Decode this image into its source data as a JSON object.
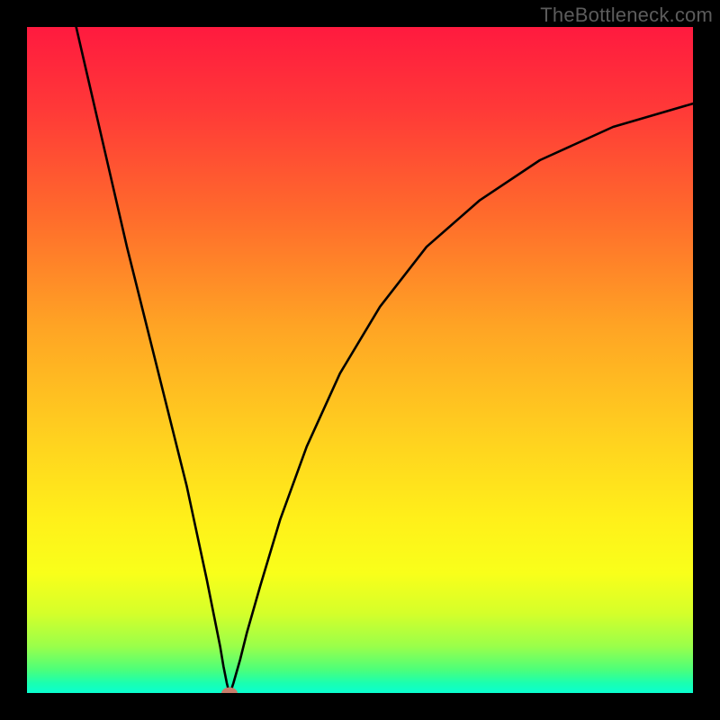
{
  "watermark": "TheBottleneck.com",
  "chart_data": {
    "type": "line",
    "title": "",
    "xlabel": "",
    "ylabel": "",
    "xlim": [
      0,
      100
    ],
    "ylim": [
      0,
      100
    ],
    "grid": false,
    "background": "vertical-gradient red→orange→yellow→green",
    "series": [
      {
        "name": "bottleneck-curve",
        "x": [
          0,
          3,
          6,
          9,
          12,
          15,
          18,
          21,
          24,
          27,
          28,
          29,
          29.5,
          30,
          30.3,
          30.6,
          31,
          32,
          33,
          35,
          38,
          42,
          47,
          53,
          60,
          68,
          77,
          88,
          100
        ],
        "y": [
          134,
          120,
          106,
          93,
          80,
          67,
          55,
          43,
          31,
          17,
          12,
          7,
          4,
          1.5,
          0.3,
          0.3,
          1.5,
          5,
          9,
          16,
          26,
          37,
          48,
          58,
          67,
          74,
          80,
          85,
          88.5
        ]
      }
    ],
    "marker": {
      "x": 30.4,
      "y": 0.0,
      "color": "#c97d6c",
      "radius": 1.2
    },
    "gradient_stops": [
      {
        "offset": 0.0,
        "color": "#ff1a3f"
      },
      {
        "offset": 0.12,
        "color": "#ff3838"
      },
      {
        "offset": 0.28,
        "color": "#ff6a2c"
      },
      {
        "offset": 0.45,
        "color": "#ffa424"
      },
      {
        "offset": 0.62,
        "color": "#ffd21f"
      },
      {
        "offset": 0.74,
        "color": "#fff01a"
      },
      {
        "offset": 0.82,
        "color": "#f9ff1a"
      },
      {
        "offset": 0.88,
        "color": "#d5ff2a"
      },
      {
        "offset": 0.93,
        "color": "#9aff4a"
      },
      {
        "offset": 0.965,
        "color": "#4cff7a"
      },
      {
        "offset": 0.985,
        "color": "#1affb0"
      },
      {
        "offset": 1.0,
        "color": "#0affd0"
      }
    ]
  }
}
